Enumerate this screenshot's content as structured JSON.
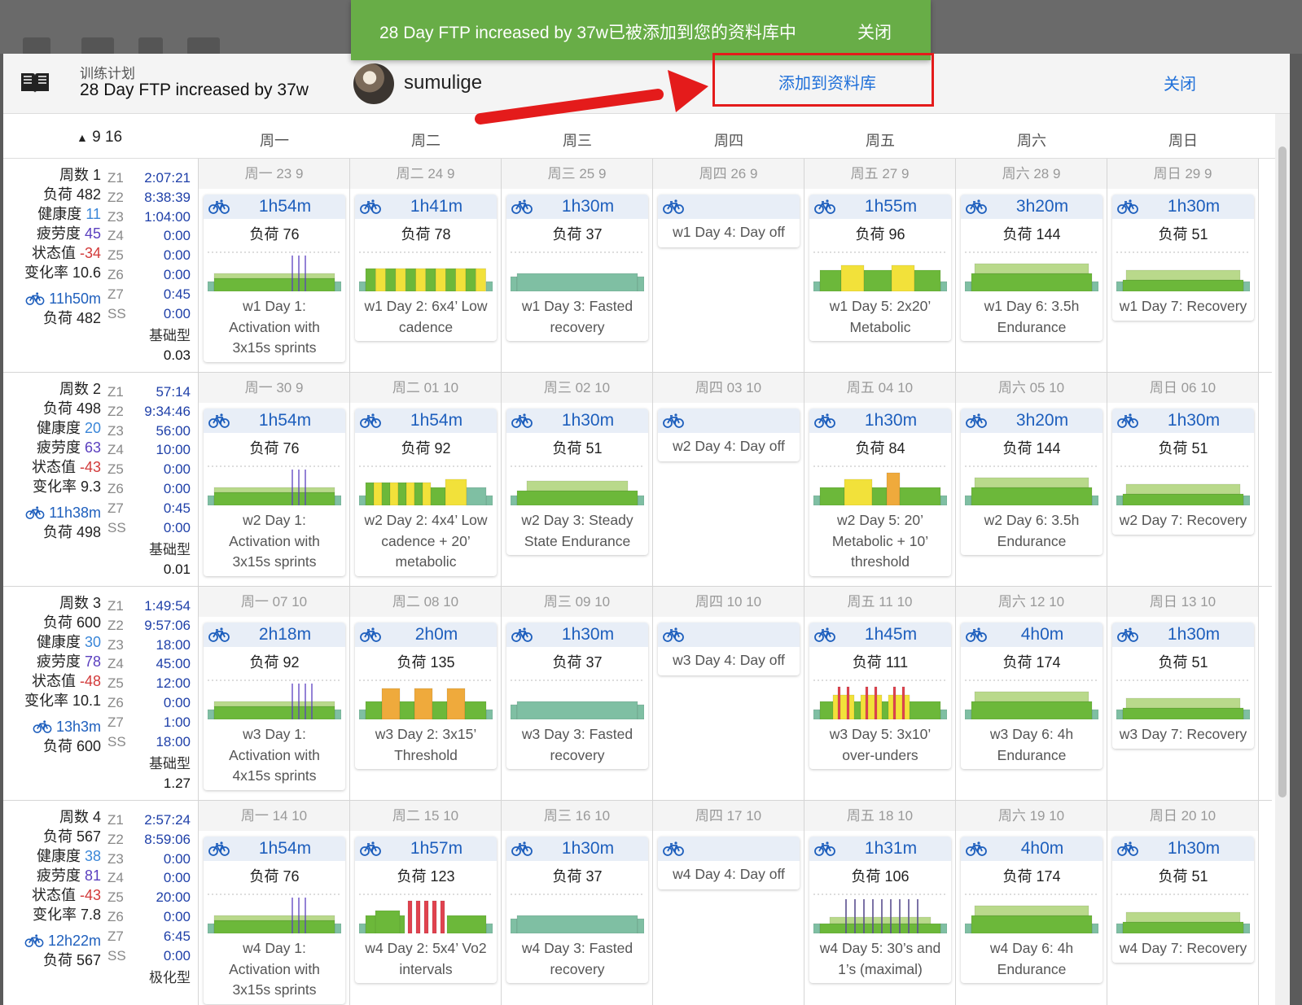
{
  "header": {
    "kicker": "训练计划",
    "title": "28 Day FTP increased by 37w",
    "username": "sumulige",
    "add_to_library": "添加到资料库",
    "close": "关闭"
  },
  "toast": {
    "message": "28 Day FTP increased by 37w已被添加到您的资料库中",
    "close": "关闭"
  },
  "week_selector": "9 16",
  "days_of_week": [
    "周一",
    "周二",
    "周三",
    "周四",
    "周五",
    "周六",
    "周日"
  ],
  "zone_labels": [
    "Z1",
    "Z2",
    "Z3",
    "Z4",
    "Z5",
    "Z6",
    "Z7",
    "SS"
  ],
  "weeks": [
    {
      "summary": {
        "week": "周数 1",
        "load_label": "负荷 482",
        "fitness_label": "健康度",
        "fitness": "11",
        "fatigue_label": "疲劳度",
        "fatigue": "45",
        "form_label": "状态值",
        "form": "-34",
        "ramp": "变化率 10.6",
        "ride_time": "11h50m",
        "ride_load": "负荷 482",
        "zones": [
          "2:07:21",
          "8:38:39",
          "1:04:00",
          "0:00",
          "0:00",
          "0:00",
          "0:45",
          "0:00"
        ],
        "category": "基础型",
        "category_value": "0.03"
      },
      "days": [
        {
          "date": "周一 23 9",
          "duration": "1h54m",
          "load": "负荷 76",
          "desc": [
            "w1 Day 1:",
            "Activation with",
            "3x15s sprints"
          ],
          "chart": "sprints"
        },
        {
          "date": "周二 24 9",
          "duration": "1h41m",
          "load": "负荷 78",
          "desc": [
            "w1 Day 2: 6x4’ Low",
            "cadence"
          ],
          "chart": "lowcad"
        },
        {
          "date": "周三 25 9",
          "duration": "1h30m",
          "load": "负荷 37",
          "desc": [
            "w1 Day 3: Fasted",
            "recovery"
          ],
          "chart": "recovery"
        },
        {
          "date": "周四 26 9",
          "off": "w1 Day 4: Day off"
        },
        {
          "date": "周五 27 9",
          "duration": "1h55m",
          "load": "负荷 96",
          "desc": [
            "w1 Day 5: 2x20’",
            "Metabolic"
          ],
          "chart": "metabolic"
        },
        {
          "date": "周六 28 9",
          "duration": "3h20m",
          "load": "负荷 144",
          "desc": [
            "w1 Day 6: 3.5h",
            "Endurance"
          ],
          "chart": "endurance"
        },
        {
          "date": "周日 29 9",
          "duration": "1h30m",
          "load": "负荷 51",
          "desc": [
            "w1 Day 7: Recovery"
          ],
          "chart": "day7"
        }
      ]
    },
    {
      "summary": {
        "week": "周数 2",
        "load_label": "负荷 498",
        "fitness_label": "健康度",
        "fitness": "20",
        "fatigue_label": "疲劳度",
        "fatigue": "63",
        "form_label": "状态值",
        "form": "-43",
        "ramp": "变化率 9.3",
        "ride_time": "11h38m",
        "ride_load": "负荷 498",
        "zones": [
          "57:14",
          "9:34:46",
          "56:00",
          "10:00",
          "0:00",
          "0:00",
          "0:45",
          "0:00"
        ],
        "category": "基础型",
        "category_value": "0.01"
      },
      "days": [
        {
          "date": "周一 30 9",
          "duration": "1h54m",
          "load": "负荷 76",
          "desc": [
            "w2 Day 1:",
            "Activation with",
            "3x15s sprints"
          ],
          "chart": "sprints"
        },
        {
          "date": "周二 01 10",
          "duration": "1h54m",
          "load": "负荷 92",
          "desc": [
            "w2 Day 2: 4x4’ Low",
            "cadence + 20’",
            "metabolic"
          ],
          "chart": "lowcad2"
        },
        {
          "date": "周三 02 10",
          "duration": "1h30m",
          "load": "负荷 51",
          "desc": [
            "w2 Day 3: Steady",
            "State Endurance"
          ],
          "chart": "steady"
        },
        {
          "date": "周四 03 10",
          "off": "w2 Day 4: Day off"
        },
        {
          "date": "周五 04 10",
          "duration": "1h30m",
          "load": "负荷 84",
          "desc": [
            "w2 Day 5: 20’",
            "Metabolic + 10’",
            "threshold"
          ],
          "chart": "metabolic2"
        },
        {
          "date": "周六 05 10",
          "duration": "3h20m",
          "load": "负荷 144",
          "desc": [
            "w2 Day 6: 3.5h",
            "Endurance"
          ],
          "chart": "endurance"
        },
        {
          "date": "周日 06 10",
          "duration": "1h30m",
          "load": "负荷 51",
          "desc": [
            "w2 Day 7: Recovery"
          ],
          "chart": "day7"
        }
      ]
    },
    {
      "summary": {
        "week": "周数 3",
        "load_label": "负荷 600",
        "fitness_label": "健康度",
        "fitness": "30",
        "fatigue_label": "疲劳度",
        "fatigue": "78",
        "form_label": "状态值",
        "form": "-48",
        "ramp": "变化率 10.1",
        "ride_time": "13h3m",
        "ride_load": "负荷 600",
        "zones": [
          "1:49:54",
          "9:57:06",
          "18:00",
          "45:00",
          "12:00",
          "0:00",
          "1:00",
          "18:00"
        ],
        "category": "基础型",
        "category_value": "1.27"
      },
      "days": [
        {
          "date": "周一 07 10",
          "duration": "2h18m",
          "load": "负荷 92",
          "desc": [
            "w3 Day 1:",
            "Activation with",
            "4x15s sprints"
          ],
          "chart": "sprints4"
        },
        {
          "date": "周二 08 10",
          "duration": "2h0m",
          "load": "负荷 135",
          "desc": [
            "w3 Day 2: 3x15’",
            "Threshold"
          ],
          "chart": "threshold"
        },
        {
          "date": "周三 09 10",
          "duration": "1h30m",
          "load": "负荷 37",
          "desc": [
            "w3 Day 3: Fasted",
            "recovery"
          ],
          "chart": "recovery"
        },
        {
          "date": "周四 10 10",
          "off": "w3 Day 4: Day off"
        },
        {
          "date": "周五 11 10",
          "duration": "1h45m",
          "load": "负荷 111",
          "desc": [
            "w3 Day 5: 3x10’",
            "over-unders"
          ],
          "chart": "overunder"
        },
        {
          "date": "周六 12 10",
          "duration": "4h0m",
          "load": "负荷 174",
          "desc": [
            "w3 Day 6: 4h",
            "Endurance"
          ],
          "chart": "endurance"
        },
        {
          "date": "周日 13 10",
          "duration": "1h30m",
          "load": "负荷 51",
          "desc": [
            "w3 Day 7: Recovery"
          ],
          "chart": "day7"
        }
      ]
    },
    {
      "summary": {
        "week": "周数 4",
        "load_label": "负荷 567",
        "fitness_label": "健康度",
        "fitness": "38",
        "fatigue_label": "疲劳度",
        "fatigue": "81",
        "form_label": "状态值",
        "form": "-43",
        "ramp": "变化率 7.8",
        "ride_time": "12h22m",
        "ride_load": "负荷 567",
        "zones": [
          "2:57:24",
          "8:59:06",
          "0:00",
          "0:00",
          "20:00",
          "0:00",
          "6:45",
          "0:00"
        ],
        "category": "极化型",
        "category_value": ""
      },
      "days": [
        {
          "date": "周一 14 10",
          "duration": "1h54m",
          "load": "负荷 76",
          "desc": [
            "w4 Day 1:",
            "Activation with",
            "3x15s sprints"
          ],
          "chart": "sprints"
        },
        {
          "date": "周二 15 10",
          "duration": "1h57m",
          "load": "负荷 123",
          "desc": [
            "w4 Day 2: 5x4’ Vo2",
            "intervals"
          ],
          "chart": "vo2"
        },
        {
          "date": "周三 16 10",
          "duration": "1h30m",
          "load": "负荷 37",
          "desc": [
            "w4 Day 3: Fasted",
            "recovery"
          ],
          "chart": "recovery"
        },
        {
          "date": "周四 17 10",
          "off": "w4 Day 4: Day off"
        },
        {
          "date": "周五 18 10",
          "duration": "1h31m",
          "load": "负荷 106",
          "desc": [
            "w4 Day 5: 30’s and",
            "1’s (maximal)"
          ],
          "chart": "maximal"
        },
        {
          "date": "周六 19 10",
          "duration": "4h0m",
          "load": "负荷 174",
          "desc": [
            "w4 Day 6: 4h",
            "Endurance"
          ],
          "chart": "endurance"
        },
        {
          "date": "周日 20 10",
          "duration": "1h30m",
          "load": "负荷 51",
          "desc": [
            "w4 Day 7: Recovery"
          ],
          "chart": "day7"
        }
      ]
    }
  ],
  "colors": {
    "z2": "#6cb83a",
    "z1": "#b9d98b",
    "recovery": "#7fbfa3",
    "sweetspot": "#f2e13a",
    "threshold": "#efaa3c",
    "vo2": "#e0434f",
    "accent_blue": "#1e6fd9",
    "toast_green": "#68ad47",
    "annotation_red": "#e41b1b"
  }
}
